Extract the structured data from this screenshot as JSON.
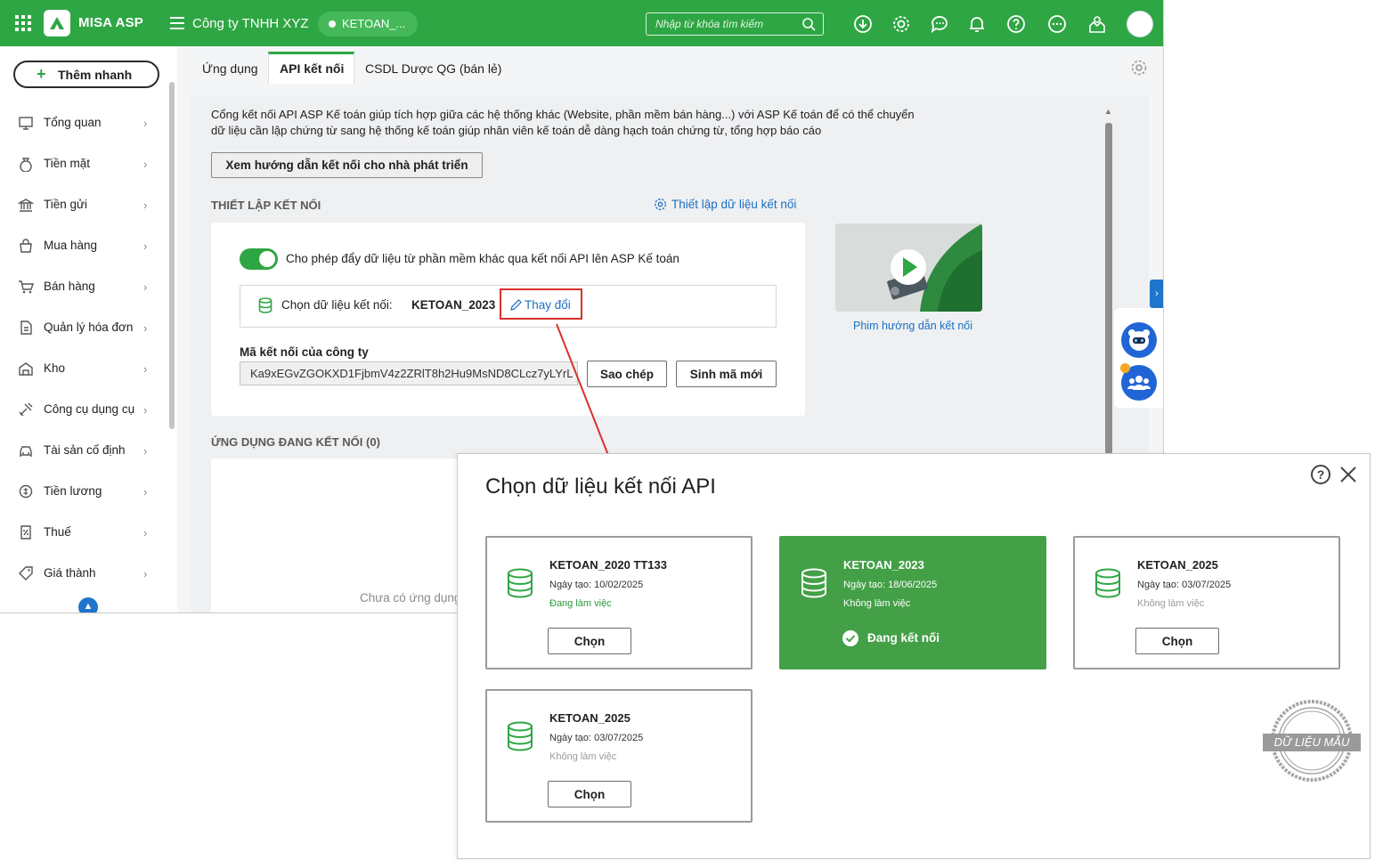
{
  "topbar": {
    "brand": "MISA ASP",
    "company": "Công ty TNHH XYZ",
    "db_pill": "KETOAN_...",
    "search_placeholder": "Nhập từ khóa tìm kiếm",
    "icons": [
      "download-icon",
      "gear-icon",
      "chat-icon",
      "bell-icon",
      "help-icon",
      "more-icon",
      "ideas-icon"
    ],
    "accent": "#2fa644"
  },
  "sidebar": {
    "quick_add": "Thêm nhanh",
    "items": [
      {
        "label": "Tổng quan",
        "icon": "dashboard-icon"
      },
      {
        "label": "Tiền mặt",
        "icon": "money-bag-icon"
      },
      {
        "label": "Tiền gửi",
        "icon": "bank-icon"
      },
      {
        "label": "Mua hàng",
        "icon": "shopping-bag-icon"
      },
      {
        "label": "Bán hàng",
        "icon": "cart-icon"
      },
      {
        "label": "Quản lý hóa đơn",
        "icon": "invoice-icon"
      },
      {
        "label": "Kho",
        "icon": "warehouse-icon"
      },
      {
        "label": "Công cụ dụng cụ",
        "icon": "tools-icon"
      },
      {
        "label": "Tài sản cố định",
        "icon": "car-icon"
      },
      {
        "label": "Tiền lương",
        "icon": "salary-icon"
      },
      {
        "label": "Thuế",
        "icon": "tax-icon"
      },
      {
        "label": "Giá thành",
        "icon": "price-tag-icon"
      }
    ]
  },
  "tabs": [
    {
      "label": "Ứng dụng"
    },
    {
      "label": "API kết nối"
    },
    {
      "label": "CSDL Dược QG (bán lẻ)"
    }
  ],
  "main": {
    "description": "Cổng kết nối API ASP Kế toán giúp tích hợp giữa các hệ thống khác (Website, phần mềm bán hàng...) với ASP Kế toán để có thể chuyển dữ liệu cần lập chứng từ sang hệ thống kế toán giúp nhân viên kế toán dễ dàng hạch toán chứng từ, tổng hợp báo cáo",
    "guide_button": "Xem hướng dẫn kết nối cho nhà phát triển",
    "setup_title": "THIẾT LẬP KẾT NỐI",
    "setup_link": "Thiết lập dữ liệu kết nối",
    "toggle_label": "Cho phép đẩy dữ liệu từ phần mềm khác qua kết nối API lên ASP Kế toán",
    "toggle_on": true,
    "choose_label": "Chọn dữ liệu kết nối:",
    "choose_value": "KETOAN_2023",
    "change_link": "Thay đổi",
    "code_label": "Mã kết nối của công ty",
    "code_value": "Ka9xEGvZGOKXD1FjbmV4z2ZRlT8h2Hu9MsND8CLcz7yLYrL",
    "copy_button": "Sao chép",
    "new_code_button": "Sinh mã mới",
    "video_caption": "Phim hướng dẫn kết nối",
    "apps_title": "ỨNG DỤNG ĐANG KẾT NỐI (0)",
    "empty_text": "Chưa có ứng dụng"
  },
  "dialog": {
    "title": "Chọn dữ liệu kết nối API",
    "cards": [
      {
        "name": "KETOAN_2020 TT133",
        "date": "Ngày tạo: 10/02/2025",
        "status": "Đang làm việc",
        "action": "Chọn",
        "selected": false
      },
      {
        "name": "KETOAN_2023",
        "date": "Ngày tạo: 18/06/2025",
        "status": "Không làm việc",
        "action": "Đang kết nối",
        "selected": true
      },
      {
        "name": "KETOAN_2025",
        "date": "Ngày tạo: 03/07/2025",
        "status": "Không làm việc",
        "action": "Chọn",
        "selected": false
      },
      {
        "name": "KETOAN_2025",
        "date": "Ngày tạo: 03/07/2025",
        "status": "Không làm việc",
        "action": "Chọn",
        "selected": false
      }
    ],
    "stamp": "DỮ LIỆU MẪU"
  }
}
